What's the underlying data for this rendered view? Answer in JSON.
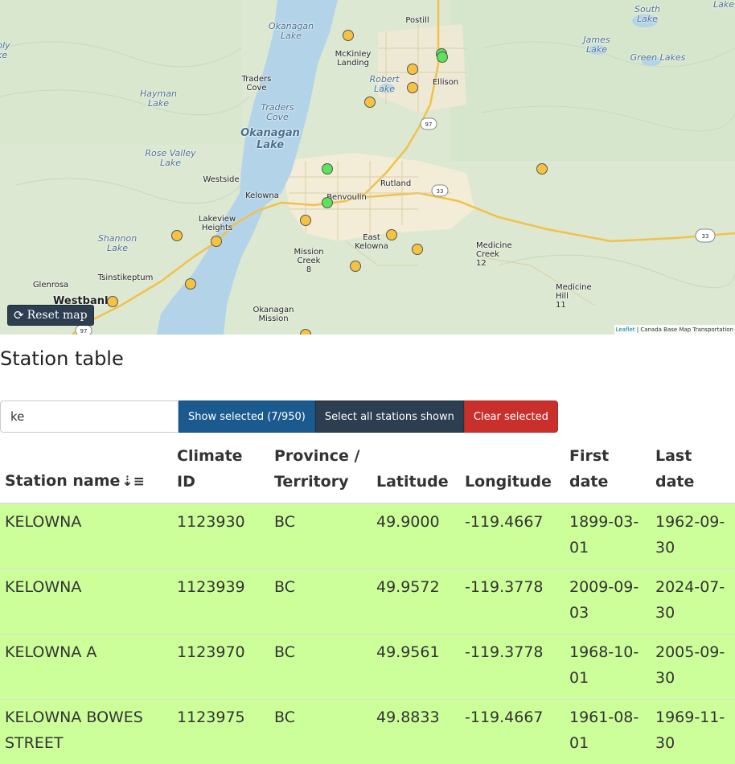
{
  "map": {
    "reset_button": {
      "label": "Reset map",
      "icon": "refresh-icon"
    },
    "attribution": {
      "leaflet": "Leaflet",
      "separator": " | ",
      "source": "Canada Base Map Transportation"
    },
    "colors": {
      "selected_station": "#5be35b",
      "unselected_station": "#f5c242",
      "water": "#b3d4e8"
    },
    "labels": {
      "okanagan_lake_north": "Okanagan\nLake",
      "okanagan_lake_main": "Okanagan\nLake",
      "postill": "Postill",
      "mckinley_landing": "McKinley\nLanding",
      "robert_lake": "Robert\nLake",
      "ellison": "Ellison",
      "james_lake": "James\nLake",
      "green_lakes": "Green Lakes",
      "south_lake": "South\nLake",
      "lake_ne": "Lake",
      "bly": "bly\nke",
      "hayman_lake": "Hayman\nLake",
      "traders_cove_town": "Traders\nCove",
      "traders_cove_water": "Traders\nCove",
      "rose_valley_lake": "Rose Valley\nLake",
      "westside": "Westside",
      "kelowna": "Kelowna",
      "benvoulin": "Benvoulin",
      "rutland": "Rutland",
      "lakeview_heights": "Lakeview\nHeights",
      "shannon_lake": "Shannon\nLake",
      "east_kelowna": "East\nKelowna",
      "mission_creek": "Mission\nCreek\n8",
      "medicine_creek": "Medicine\nCreek\n12",
      "medicine_hill": "Medicine\nHill\n11",
      "tsinstikeptum": "Tsinstikeptum",
      "glenrosa": "Glenrosa",
      "westbank": "Westbank",
      "okanagan_mission": "Okanagan\nMission",
      "hwy_97a": "97",
      "hwy_97b": "97",
      "hwy_33a": "33",
      "hwy_33b": "33"
    }
  },
  "table_section": {
    "title": "Station table",
    "filter": {
      "value": "ke",
      "placeholder": ""
    },
    "buttons": {
      "show_selected": "Show selected (7/950)",
      "select_all": "Select all stations shown",
      "clear_selected": "Clear selected"
    },
    "sort_icon": "sort-alpha-down-icon",
    "columns": [
      "Station name",
      "Climate ID",
      "Province / Territory",
      "Latitude",
      "Longitude",
      "First date",
      "Last date"
    ],
    "rows": [
      {
        "name": "KELOWNA",
        "climate_id": "1123930",
        "province": "BC",
        "lat": "49.9000",
        "lon": "-119.4667",
        "first": "1899-03-01",
        "last": "1962-09-30"
      },
      {
        "name": "KELOWNA",
        "climate_id": "1123939",
        "province": "BC",
        "lat": "49.9572",
        "lon": "-119.3778",
        "first": "2009-09-03",
        "last": "2024-07-30"
      },
      {
        "name": "KELOWNA A",
        "climate_id": "1123970",
        "province": "BC",
        "lat": "49.9561",
        "lon": "-119.3778",
        "first": "1968-10-01",
        "last": "2005-09-30"
      },
      {
        "name": "KELOWNA BOWES STREET",
        "climate_id": "1123975",
        "province": "BC",
        "lat": "49.8833",
        "lon": "-119.4667",
        "first": "1961-08-01",
        "last": "1969-11-30"
      }
    ]
  }
}
